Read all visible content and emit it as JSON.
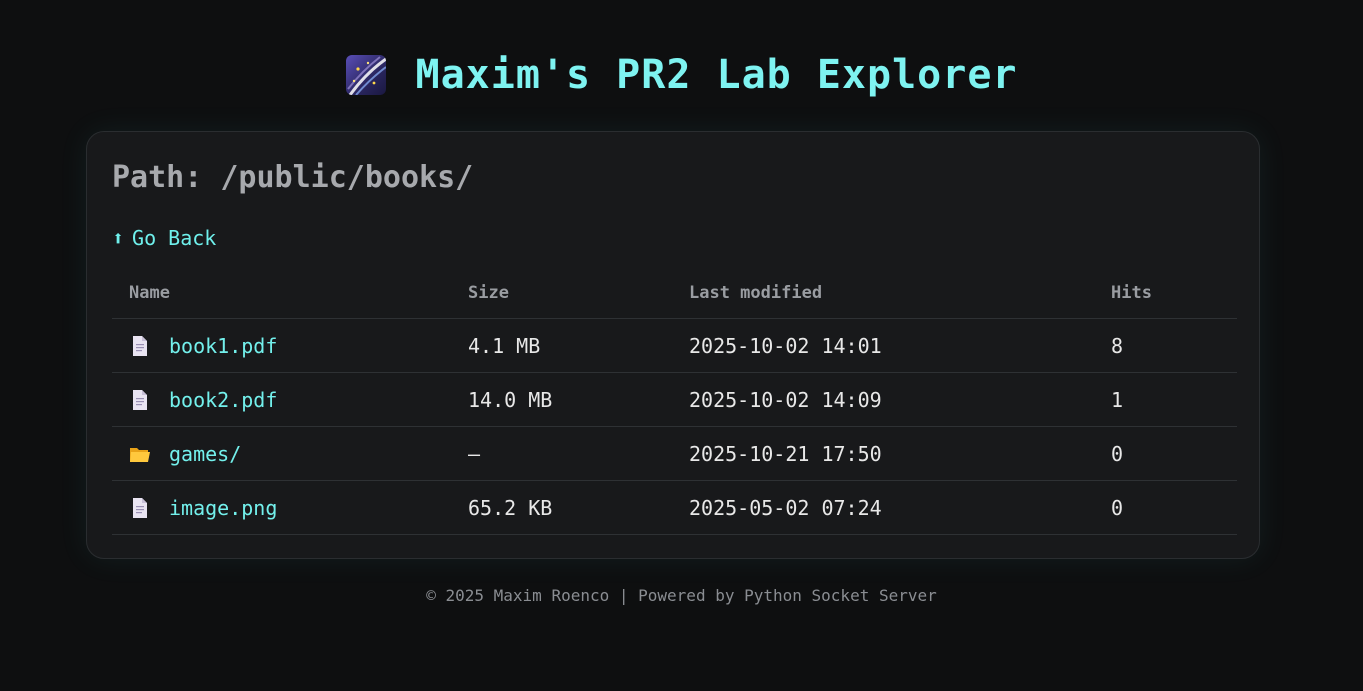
{
  "header": {
    "title": "Maxim's PR2 Lab Explorer",
    "logo_icon": "shooting-star-icon"
  },
  "path": {
    "text": "Path: /public/books/"
  },
  "go_back": {
    "arrow": "⬆",
    "label": "Go Back"
  },
  "table": {
    "columns": [
      "Name",
      "Size",
      "Last modified",
      "Hits"
    ],
    "rows": [
      {
        "icon": "file-icon",
        "name": "book1.pdf",
        "size": "4.1 MB",
        "modified": "2025-10-02 14:01",
        "hits": "8"
      },
      {
        "icon": "file-icon",
        "name": "book2.pdf",
        "size": "14.0 MB",
        "modified": "2025-10-02 14:09",
        "hits": "1"
      },
      {
        "icon": "folder-icon",
        "name": "games/",
        "size": "—",
        "modified": "2025-10-21 17:50",
        "hits": "0"
      },
      {
        "icon": "file-icon",
        "name": "image.png",
        "size": "65.2 KB",
        "modified": "2025-05-02 07:24",
        "hits": "0"
      }
    ]
  },
  "footer": {
    "text": "© 2025 Maxim Roenco | Powered by Python Socket Server"
  },
  "colors": {
    "accent": "#7ef3f1",
    "background": "#0e0f10",
    "panel": "#18191b"
  }
}
